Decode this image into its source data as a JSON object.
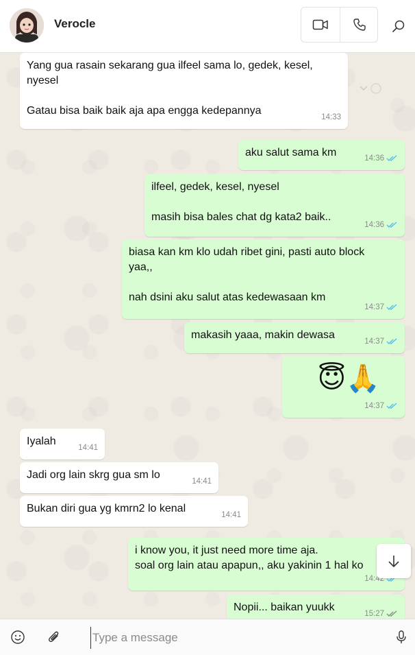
{
  "header": {
    "contact_name": "Verocle",
    "video_call_icon": "video-camera-icon",
    "voice_call_icon": "phone-icon",
    "search_icon": "search-icon"
  },
  "messages": [
    {
      "dir": "in",
      "text": "Yang gua rasain sekarang gua ilfeel sama lo, gedek, kesel,\nnyesel\n\nGatau bisa baik baik aja apa engga kedepannya",
      "time": "14:33"
    },
    {
      "dir": "out",
      "text": "aku salut sama km",
      "time": "14:36",
      "status": "read"
    },
    {
      "dir": "out",
      "text": "ilfeel, gedek, kesel, nyesel\n\nmasih bisa bales chat dg kata2 baik..",
      "time": "14:36",
      "status": "read"
    },
    {
      "dir": "out",
      "text": "biasa kan km klo udah ribet gini, pasti auto block\nyaa,,\n\nnah dsini aku salut atas kedewasaan km",
      "time": "14:37",
      "status": "read"
    },
    {
      "dir": "out",
      "text": "makasih yaaa, makin dewasa",
      "time": "14:37",
      "status": "read"
    },
    {
      "dir": "out",
      "text": "😇🙏",
      "time": "14:37",
      "status": "read",
      "emoji": true
    },
    {
      "dir": "in",
      "text": "Iyalah",
      "time": "14:41"
    },
    {
      "dir": "in",
      "text": "Jadi org lain skrg gua sm lo",
      "time": "14:41"
    },
    {
      "dir": "in",
      "text": "Bukan diri gua yg kmrn2 lo kenal",
      "time": "14:41"
    },
    {
      "dir": "out",
      "text": "i know you, it just need more time aja.\nsoal org lain atau apapun,, aku yakinin 1 hal ko",
      "time": "14:42",
      "status": "read"
    },
    {
      "dir": "out",
      "text": "Nopii... baikan yuukk",
      "time": "15:27",
      "status": "delivered"
    }
  ],
  "composer": {
    "placeholder": "Type a message",
    "emoji_icon": "emoji-icon",
    "attach_icon": "paperclip-icon",
    "mic_icon": "microphone-icon"
  },
  "colors": {
    "incoming_bubble": "#ffffff",
    "outgoing_bubble": "#d9fdd3",
    "read_ticks": "#53bdeb",
    "delivered_ticks": "#8a8a8a",
    "chat_background": "#efeae2"
  }
}
